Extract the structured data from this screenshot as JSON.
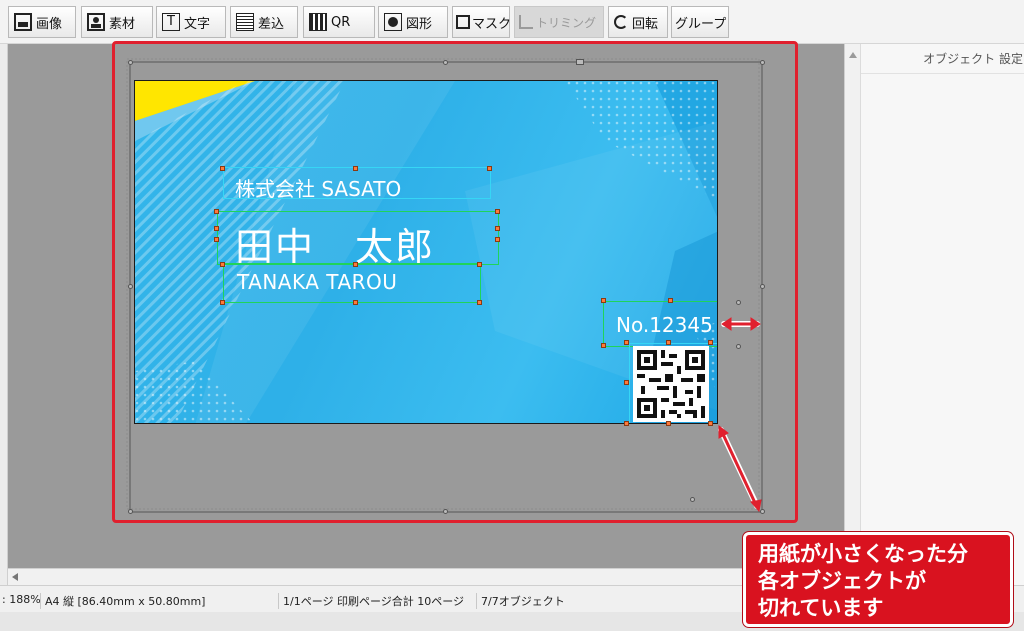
{
  "toolbar": {
    "buttons": [
      {
        "label": "画像",
        "icon": "image-icon"
      },
      {
        "label": "素材",
        "icon": "material-icon"
      },
      {
        "label": "文字",
        "icon": "text-icon"
      },
      {
        "label": "差込",
        "icon": "insert-icon"
      },
      {
        "label": "QR",
        "icon": "qr-icon"
      },
      {
        "label": "図形",
        "icon": "shape-icon"
      },
      {
        "label": "マスク",
        "icon": "mask-icon"
      },
      {
        "label": "トリミング",
        "icon": "trim-icon"
      },
      {
        "label": "回転",
        "icon": "rotate-icon"
      },
      {
        "label": "グループ",
        "icon": ""
      }
    ]
  },
  "right_panel": {
    "title": "オブジェクト 設定"
  },
  "card": {
    "company": "株式会社 SASATO",
    "name": "田中　太郎",
    "romaji": "TANAKA TAROU",
    "number": "No.12345",
    "colors": {
      "background": "#34b6ea",
      "accent": "#ffe600",
      "text": "#ffffff"
    }
  },
  "callout": {
    "text": "用紙が小さくなった分\n各オブジェクトが\n切れています"
  },
  "statusbar": {
    "zoom": ": 188%",
    "paper": "A4 縦 [86.40mm x 50.80mm]",
    "page": "1/1ページ 印刷ページ合計 10ページ",
    "objects": "7/7オブジェクト"
  },
  "colors": {
    "annotation": "#e0202e",
    "selection": "#1fd45a"
  }
}
